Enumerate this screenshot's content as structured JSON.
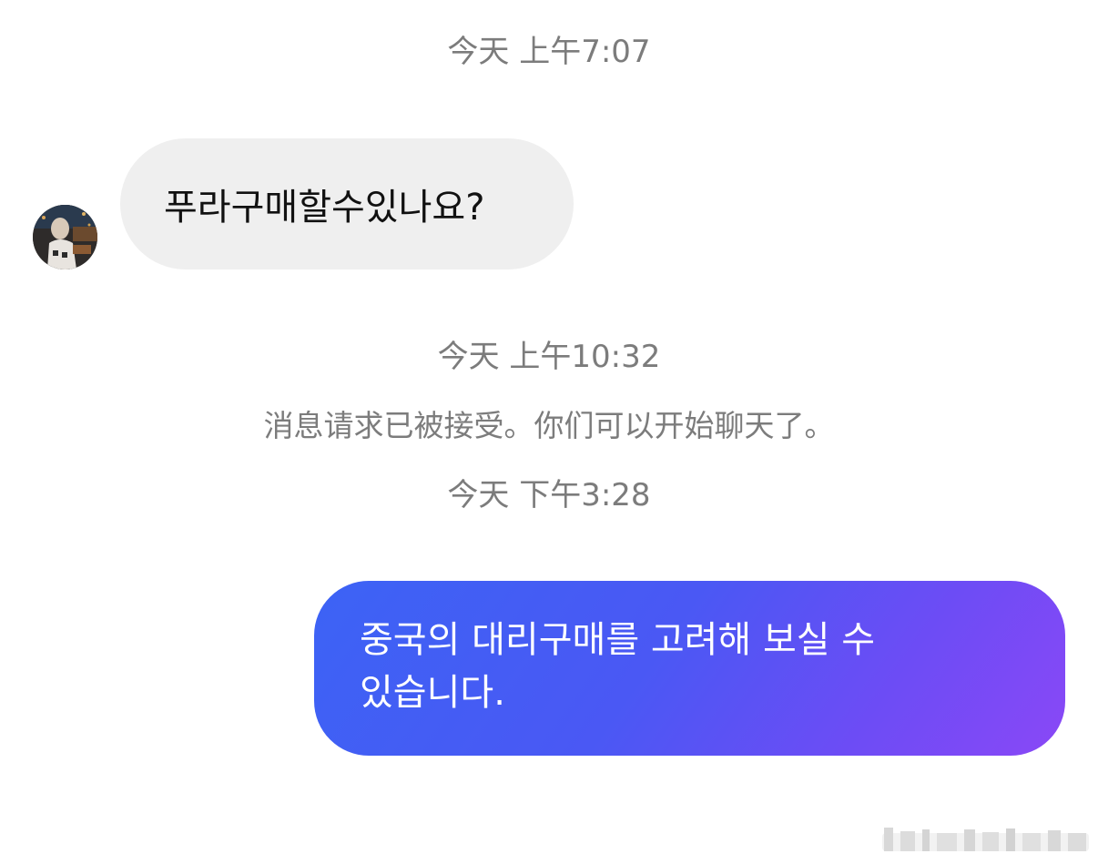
{
  "thread": {
    "timestamp_1": "今天 上午7:07",
    "incoming_message": "푸라구매할수있나요?",
    "timestamp_2": "今天 上午10:32",
    "system_message": "消息请求已被接受。你们可以开始聊天了。",
    "timestamp_3": "今天 下午3:28",
    "outgoing_message": "중국의 대리구매를 고려해 보실 수 있습니다."
  },
  "colors": {
    "incoming_bubble": "#efefef",
    "outgoing_gradient_start": "#3c63f5",
    "outgoing_gradient_end": "#8a48f6",
    "meta_text": "#7c7c7c"
  },
  "icons": {
    "avatar": "user-avatar-photo",
    "watermark": "blurred-watermark"
  }
}
